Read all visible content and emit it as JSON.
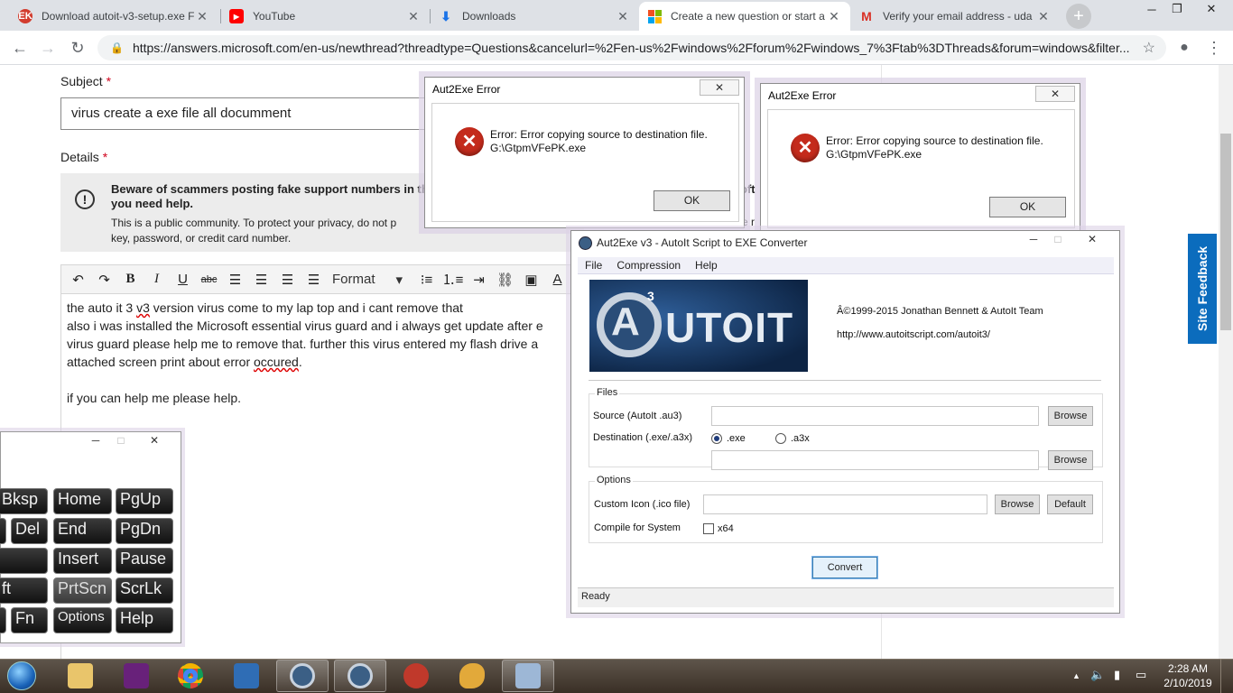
{
  "browser": {
    "tabs": [
      {
        "title": "Download autoit-v3-setup.exe F",
        "fav_color": "#d23c2e",
        "fav": "EK"
      },
      {
        "title": "YouTube",
        "fav_color": "#ff0000",
        "fav": "▶"
      },
      {
        "title": "Downloads",
        "fav_color": "#1a73e8",
        "fav": "⬇"
      },
      {
        "title": "Create a new question or start a",
        "fav_color": "#f25022",
        "fav": "■"
      },
      {
        "title": "Verify your email address - uda",
        "fav_color": "#ffffff",
        "fav": "M"
      }
    ],
    "tab_close": "✕",
    "new_tab": "+",
    "window_buttons": [
      "─",
      "❐",
      "✕"
    ],
    "nav": {
      "back": "←",
      "forward": "→",
      "reload": "↻"
    },
    "url": "https://answers.microsoft.com/en-us/newthread?threadtype=Questions&cancelurl=%2Fen-us%2Fwindows%2Fforum%2Fwindows_7%3Ftab%3DThreads&forum=windows&filter...",
    "lock_icon": "🔒",
    "star_icon": "☆",
    "account_icon": "●",
    "menu_icon": "⋮"
  },
  "form": {
    "subject_label": "Subject",
    "required_mark": "*",
    "subject_value": "virus create a exe file all documment",
    "details_label": "Details",
    "warning_bold": "Beware of scammers posting fake support numbers in the",
    "warning_bold_right": "oft",
    "warning_bold_2": "you need help.",
    "warning_text": "This is a public community. To protect your privacy, do not p",
    "warning_text_right": "e r",
    "warning_text_2": "key, password, or credit card number.",
    "format_label": "Format",
    "editor_lines": [
      "the auto it 3 v3 version virus come to my lap top and i cant remove that",
      "also i was installed the Microsoft essential virus guard and i always get update after e",
      "virus guard please help me to remove that. further this virus entered my flash drive a",
      "attached screen print about error occured.",
      "",
      "if you can help me please help."
    ],
    "site_feedback": "Site Feedback"
  },
  "error_dialog_1": {
    "title": "Aut2Exe Error",
    "message_line1": "Error: Error copying source to destination file.",
    "message_line2": "G:\\GtpmVFePK.exe",
    "ok": "OK"
  },
  "error_dialog_2": {
    "title": "Aut2Exe Error",
    "message_line1": "Error: Error copying source to destination file.",
    "message_line2": "G:\\GtpmVFePK.exe",
    "ok": "OK"
  },
  "aut2exe": {
    "title": "Aut2Exe v3 - AutoIt Script to EXE Converter",
    "menu": [
      "File",
      "Compression",
      "Help"
    ],
    "logo_text": "UTOIT",
    "logo_a": "A",
    "logo_sup": "3",
    "copyright": "Â©1999-2015 Jonathan Bennett & AutoIt Team",
    "website": "http://www.autoitscript.com/autoit3/",
    "files_group": "Files",
    "source_label": "Source (AutoIt .au3)",
    "destination_label": "Destination (.exe/.a3x)",
    "radio_exe": ".exe",
    "radio_a3x": ".a3x",
    "browse": "Browse",
    "options_group": "Options",
    "custom_icon_label": "Custom Icon (.ico file)",
    "default": "Default",
    "compile_label": "Compile for System",
    "x64": "x64",
    "convert": "Convert",
    "status": "Ready"
  },
  "osk": {
    "keys": [
      {
        "label": "Bksp"
      },
      {
        "label": "Home"
      },
      {
        "label": "PgUp"
      },
      {
        "label": ""
      },
      {
        "label": "Del"
      },
      {
        "label": "End"
      },
      {
        "label": "PgDn"
      },
      {
        "label": ""
      },
      {
        "label": "Insert"
      },
      {
        "label": "Pause"
      },
      {
        "label": "ft"
      },
      {
        "label": "PrtScn"
      },
      {
        "label": "ScrLk"
      },
      {
        "label": ""
      },
      {
        "label": "Fn"
      },
      {
        "label": "Options"
      },
      {
        "label": "Help"
      }
    ]
  },
  "taskbar": {
    "time": "2:28 AM",
    "date": "2/10/2019",
    "tray_up": "▲",
    "tray_speaker": "🔈",
    "tray_signal": "▮",
    "tray_battery": "▭",
    "apps": [
      {
        "name": "explorer",
        "color": "#e9c56b"
      },
      {
        "name": "visual-studio",
        "color": "#68217a"
      },
      {
        "name": "chrome",
        "color": "#db4437"
      },
      {
        "name": "network-app",
        "color": "#2f6db5"
      },
      {
        "name": "autoit-1",
        "color": "#3b5f85"
      },
      {
        "name": "autoit-2",
        "color": "#3b5f85"
      },
      {
        "name": "recorder",
        "color": "#c0392b"
      },
      {
        "name": "paint",
        "color": "#e2a93a"
      },
      {
        "name": "keyboard",
        "color": "#9db7d6"
      }
    ]
  }
}
